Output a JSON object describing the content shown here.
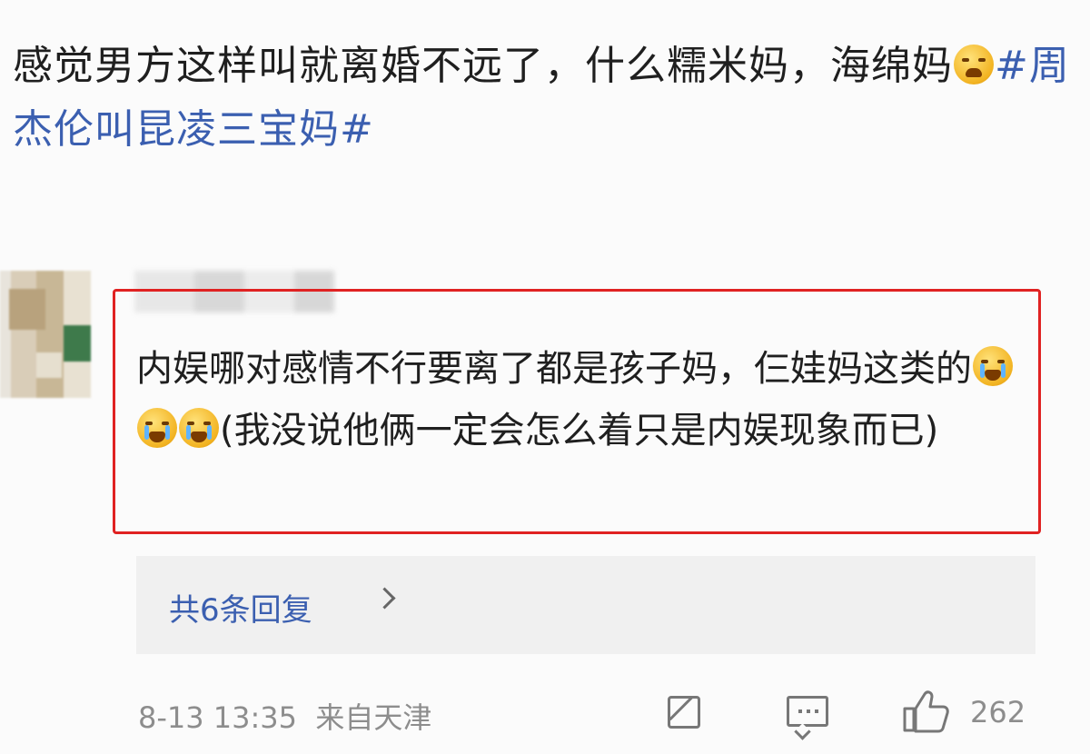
{
  "post": {
    "text_line": "感觉男方这样叫就离婚不远了，什么糯米妈，海绵妈",
    "emoji": "laugh-cry-emoji",
    "hashtag": "#周杰伦叫昆凌三宝妈#"
  },
  "comment": {
    "text_part1": "内娱哪对感情不行要离了都是孩子妈，仨娃妈这类的",
    "emojis": [
      "crying-emoji",
      "crying-emoji",
      "crying-emoji"
    ],
    "text_part2": "(我没说他俩一定会怎么着只是内娱现象而已)",
    "highlight_color": "#e02222"
  },
  "replies": {
    "label": "共6条回复",
    "icon": "chevron-right-icon"
  },
  "footer": {
    "timestamp": "8-13 13:35",
    "source": "来自天津",
    "share_icon": "share-icon",
    "comment_icon": "comment-icon",
    "like_icon": "like-icon",
    "like_count": "262"
  },
  "colors": {
    "link": "#3b5fb0",
    "meta": "#8d8d8d"
  }
}
